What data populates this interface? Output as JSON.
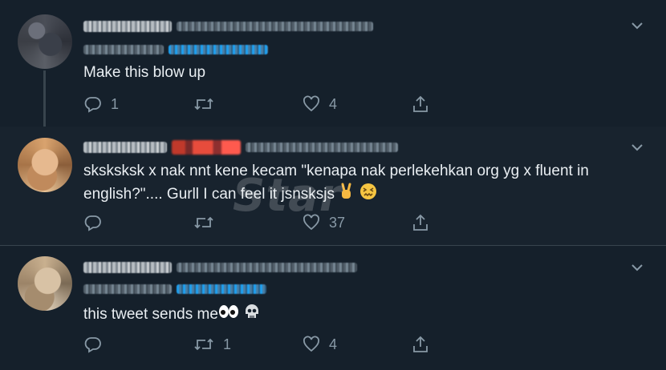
{
  "tweets": [
    {
      "text": "Make this blow up",
      "replies": "1",
      "retweets": "",
      "likes": "4"
    },
    {
      "text_line1": "sksksksk x nak nnt kene kecam \"kenapa nak perlekehkan org yg x fluent in",
      "text_line2": "english?\".... Gurll I can feel it jsnsksjs",
      "replies": "",
      "retweets": "",
      "likes": "37"
    },
    {
      "text": "this tweet sends me",
      "replies": "",
      "retweets": "1",
      "likes": "4"
    }
  ],
  "watermark": "Star",
  "icons": {
    "reply": "reply-icon",
    "retweet": "retweet-icon",
    "like": "heart-icon",
    "share": "share-icon",
    "menu": "chevron-down-icon"
  },
  "colors": {
    "background": "#15202b",
    "text": "#e6ecf0",
    "muted": "#8899a6",
    "link": "#1da1f2",
    "divider": "#38444d"
  }
}
